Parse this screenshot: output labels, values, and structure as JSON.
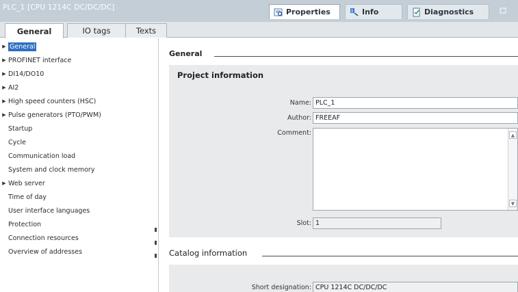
{
  "window": {
    "title": "PLC_1 [CPU 1214C DC/DC/DC]",
    "tabs": [
      {
        "label": "Properties"
      },
      {
        "label": "Info"
      },
      {
        "label": "Diagnostics"
      }
    ]
  },
  "subtabs": [
    "General",
    "IO tags",
    "Texts"
  ],
  "tree": [
    {
      "label": "General",
      "expandable": true,
      "selected": true
    },
    {
      "label": "PROFINET interface",
      "expandable": true
    },
    {
      "label": "DI14/DO10",
      "expandable": true
    },
    {
      "label": "AI2",
      "expandable": true
    },
    {
      "label": "High speed counters (HSC)",
      "expandable": true
    },
    {
      "label": "Pulse generators (PTO/PWM)",
      "expandable": true
    },
    {
      "label": "Startup",
      "expandable": false
    },
    {
      "label": "Cycle",
      "expandable": false
    },
    {
      "label": "Communication load",
      "expandable": false
    },
    {
      "label": "System and clock memory",
      "expandable": false
    },
    {
      "label": "Web server",
      "expandable": true
    },
    {
      "label": "Time of day",
      "expandable": false
    },
    {
      "label": "User interface languages",
      "expandable": false
    },
    {
      "label": "Protection",
      "expandable": false
    },
    {
      "label": "Connection resources",
      "expandable": false
    },
    {
      "label": "Overview of addresses",
      "expandable": false
    }
  ],
  "panel": {
    "section_title": "General",
    "project_info_title": "Project information",
    "name_label": "Name:",
    "name_value": "PLC_1",
    "author_label": "Author:",
    "author_value": "FREEAF",
    "comment_label": "Comment:",
    "comment_value": "",
    "slot_label": "Slot:",
    "slot_value": "1",
    "catalog_title": "Catalog information",
    "short_designation_label": "Short designation:",
    "short_designation_value": "CPU 1214C DC/DC/DC"
  }
}
